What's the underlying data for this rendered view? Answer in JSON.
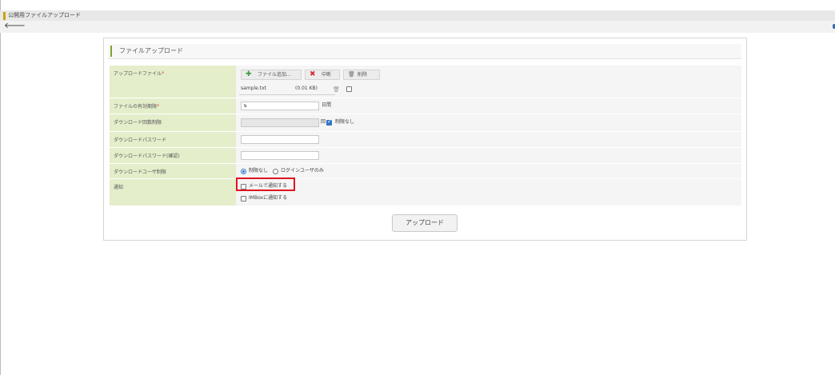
{
  "window": {
    "title": "公開用ファイルアップロード"
  },
  "panel": {
    "title": "ファイルアップロード"
  },
  "form": {
    "upload_file": {
      "label": "アップロードファイル",
      "required_mark": "*",
      "add_button": "ファイル追加...",
      "abort_button": "中断",
      "delete_button": "削除",
      "file_name": "sample.txt",
      "file_size": "(0.01 KB)"
    },
    "expiry": {
      "label": "ファイルの有効期限",
      "required_mark": "*",
      "value": "5",
      "unit": "日間"
    },
    "download_limit": {
      "label": "ダウンロード回数制限",
      "value": "",
      "unit": "回",
      "unlimited_label": "制限なし",
      "unlimited_checked": true
    },
    "download_password": {
      "label": "ダウンロードパスワード",
      "value": ""
    },
    "download_password_confirm": {
      "label": "ダウンロードパスワード(確認)",
      "value": ""
    },
    "download_user_limit": {
      "label": "ダウンロードユーザ制限",
      "option_none": "制限なし",
      "option_login": "ログインユーザのみ",
      "selected": "制限なし"
    },
    "notify": {
      "label": "通知",
      "mail_label": "メールで通知する",
      "mail_checked": false,
      "imbox_label": "IMBoxに通知する",
      "imbox_checked": false
    }
  },
  "actions": {
    "upload_button": "アップロード"
  },
  "colors": {
    "label_bg": "#e4eecb",
    "accent": "#7aa332",
    "highlight": "#e0141e"
  }
}
